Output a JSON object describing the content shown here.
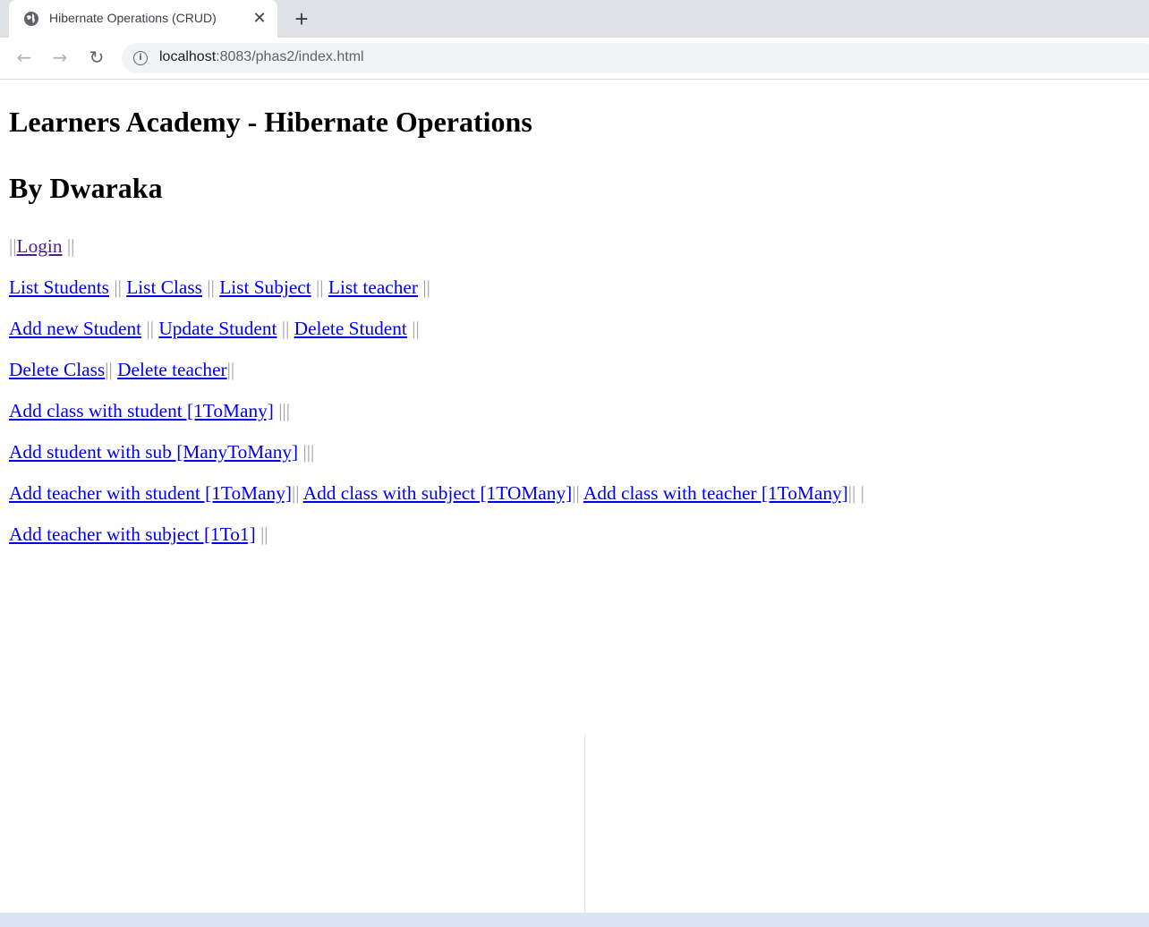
{
  "browser": {
    "tab_title": "Hibernate Operations (CRUD)",
    "tab_close": "✕",
    "new_tab": "+",
    "url_host": "localhost",
    "url_path": ":8083/phas2/index.html",
    "icons": {
      "back": "back-arrow-icon",
      "forward": "forward-arrow-icon",
      "reload": "reload-icon",
      "info": "info-icon",
      "tab": "globe-icon"
    }
  },
  "page": {
    "heading1": "Learners Academy - Hibernate Operations",
    "heading2": "By Dwaraka",
    "sep_double": "||",
    "sep_double_sp": " ||",
    "sep_triple": "|||",
    "sep_single": "|",
    "login": "Login",
    "list_students": "List Students",
    "list_class": "List Class",
    "list_subject": "List Subject",
    "list_teacher": "List teacher",
    "add_new_student": "Add new Student",
    "update_student": "Update Student",
    "delete_student": "Delete Student",
    "delete_class": "Delete Class",
    "delete_teacher": "Delete teacher",
    "add_class_with_student": "Add class with student [1ToMany]",
    "add_student_with_sub": "Add student with sub [ManyToMany]",
    "add_teacher_with_student": "Add teacher with student [1ToMany]",
    "add_class_with_subject": "Add class with subject [1TOMany]",
    "add_class_with_teacher": "Add class with teacher [1ToMany]",
    "add_teacher_with_subject": "Add teacher with subject [1To1]"
  },
  "colors": {
    "link": "#0000ee",
    "visited_link": "#551a8b",
    "separator": "#9e9e9e",
    "tabstrip": "#dee1e6"
  }
}
